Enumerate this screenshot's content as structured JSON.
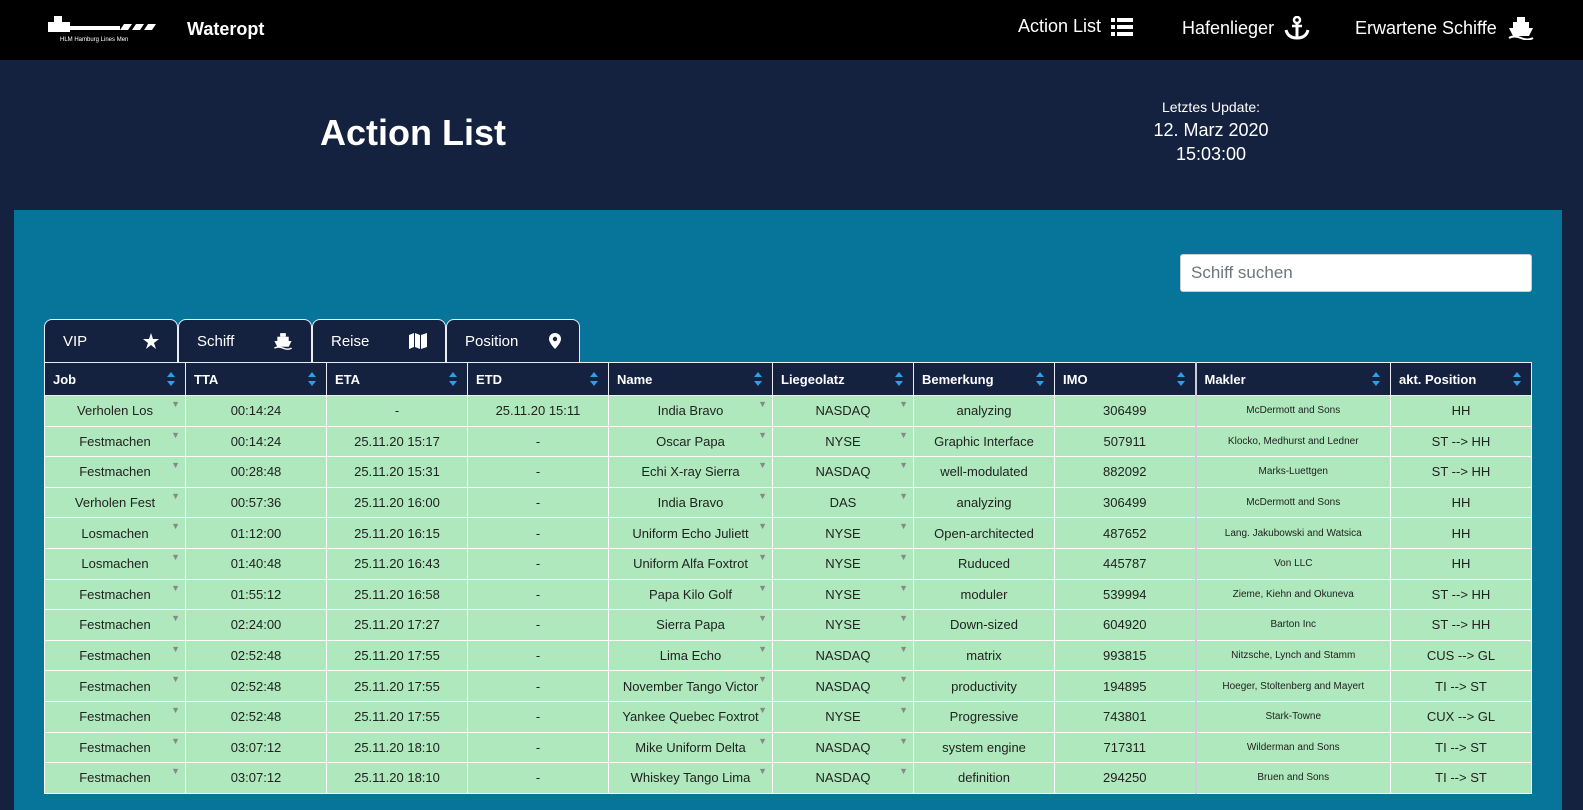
{
  "topbar": {
    "logo_text": "HLM Hamburg Lines Men",
    "brand": "Wateropt",
    "nav": [
      {
        "label": "Action List",
        "icon": "list-icon"
      },
      {
        "label": "Hafenlieger",
        "icon": "anchor-icon"
      },
      {
        "label": "Erwartene Schiffe",
        "icon": "ship-icon"
      }
    ]
  },
  "header": {
    "title": "Action List",
    "update_label": "Letztes Update:",
    "update_date": "12. Marz 2020",
    "update_time": "15:03:00"
  },
  "search": {
    "placeholder": "Schiff suchen"
  },
  "tabs": [
    {
      "label": "VIP",
      "icon": "star-icon"
    },
    {
      "label": "Schiff",
      "icon": "ship-icon"
    },
    {
      "label": "Reise",
      "icon": "map-icon"
    },
    {
      "label": "Position",
      "icon": "map-marker-icon"
    }
  ],
  "table": {
    "columns": [
      "Job",
      "TTA",
      "ETA",
      "ETD",
      "Name",
      "Liegeolatz",
      "Bemerkung",
      "IMO",
      "Makler",
      "akt. Position"
    ],
    "rows": [
      [
        "Verholen Los",
        "00:14:24",
        "-",
        "25.11.20 15:11",
        "India Bravo",
        "NASDAQ",
        "analyzing",
        "306499",
        "McDermott and Sons",
        "HH"
      ],
      [
        "Festmachen",
        "00:14:24",
        "25.11.20 15:17",
        "-",
        "Oscar Papa",
        "NYSE",
        "Graphic Interface",
        "507911",
        "Klocko, Medhurst and Ledner",
        "ST --> HH"
      ],
      [
        "Festmachen",
        "00:28:48",
        "25.11.20 15:31",
        "-",
        "Echi X-ray Sierra",
        "NASDAQ",
        "well-modulated",
        "882092",
        "Marks-Luettgen",
        "ST --> HH"
      ],
      [
        "Verholen Fest",
        "00:57:36",
        "25.11.20 16:00",
        "-",
        "India Bravo",
        "DAS",
        "analyzing",
        "306499",
        "McDermott and Sons",
        "HH"
      ],
      [
        "Losmachen",
        "01:12:00",
        "25.11.20 16:15",
        "-",
        "Uniform Echo Juliett",
        "NYSE",
        "Open-architected",
        "487652",
        "Lang. Jakubowski and Watsica",
        "HH"
      ],
      [
        "Losmachen",
        "01:40:48",
        "25.11.20 16:43",
        "-",
        "Uniform Alfa Foxtrot",
        "NYSE",
        "Ruduced",
        "445787",
        "Von LLC",
        "HH"
      ],
      [
        "Festmachen",
        "01:55:12",
        "25.11.20 16:58",
        "-",
        "Papa Kilo Golf",
        "NYSE",
        "moduler",
        "539994",
        "Zieme, Kiehn and Okuneva",
        "ST --> HH"
      ],
      [
        "Festmachen",
        "02:24:00",
        "25.11.20 17:27",
        "-",
        "Sierra Papa",
        "NYSE",
        "Down-sized",
        "604920",
        "Barton Inc",
        "ST --> HH"
      ],
      [
        "Festmachen",
        "02:52:48",
        "25.11.20 17:55",
        "-",
        "Lima Echo",
        "NASDAQ",
        "matrix",
        "993815",
        "Nitzsche, Lynch and Stamm",
        "CUS --> GL"
      ],
      [
        "Festmachen",
        "02:52:48",
        "25.11.20 17:55",
        "-",
        "November Tango Victor",
        "NASDAQ",
        "productivity",
        "194895",
        "Hoeger, Stoltenberg and Mayert",
        "TI --> ST"
      ],
      [
        "Festmachen",
        "02:52:48",
        "25.11.20 17:55",
        "-",
        "Yankee Quebec Foxtrot",
        "NYSE",
        "Progressive",
        "743801",
        "Stark-Towne",
        "CUX --> GL"
      ],
      [
        "Festmachen",
        "03:07:12",
        "25.11.20 18:10",
        "-",
        "Mike Uniform Delta",
        "NASDAQ",
        "system engine",
        "717311",
        "Wilderman and Sons",
        "TI --> ST"
      ],
      [
        "Festmachen",
        "03:07:12",
        "25.11.20 18:10",
        "-",
        "Whiskey Tango Lima",
        "NASDAQ",
        "definition",
        "294250",
        "Bruen and Sons",
        "TI --> ST"
      ]
    ]
  }
}
